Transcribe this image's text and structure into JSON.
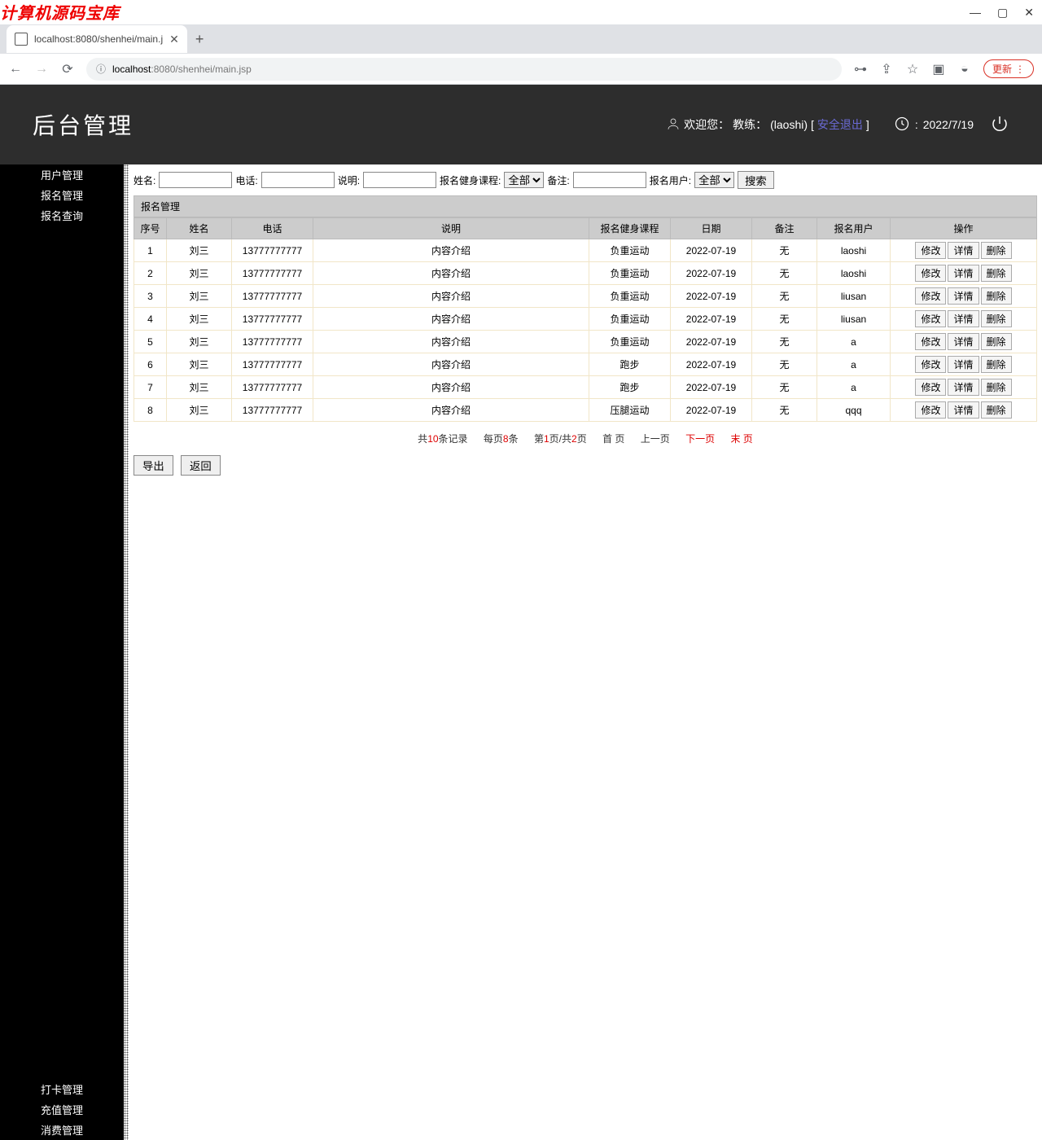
{
  "watermark": "计算机源码宝库",
  "browser": {
    "tab_title": "localhost:8080/shenhei/main.j",
    "url_host": "localhost",
    "url_port": ":8080",
    "url_path": "/shenhei/main.jsp",
    "update_label": "更新",
    "win_min": "—",
    "win_max": "▢",
    "win_close": "✕",
    "new_tab": "+",
    "tab_close": "✕",
    "back": "←",
    "forward": "→",
    "reload": "⟳",
    "info": "ⓘ",
    "key": "⊶",
    "share": "⇪",
    "star": "☆",
    "ext": "▣",
    "user": "◒",
    "more": "⋮"
  },
  "header": {
    "app_title": "后台管理",
    "welcome_prefix": "欢迎您：",
    "role": "教练：",
    "username": "(laoshi)",
    "bracket_open": "[",
    "bracket_close": "]",
    "logout_link": "安全退出",
    "date": "2022/7/19",
    "clock_symbol": "⏱"
  },
  "sidebar": {
    "top": [
      "用户管理",
      "报名管理",
      "报名查询"
    ],
    "bottom": [
      "打卡管理",
      "充值管理",
      "消费管理"
    ]
  },
  "search": {
    "name_label": "姓名:",
    "phone_label": "电话:",
    "desc_label": "说明:",
    "course_label": "报名健身课程:",
    "course_value": "全部",
    "remark_label": "备注:",
    "user_label": "报名用户:",
    "user_value": "全部",
    "button": "搜索",
    "name_val": "",
    "phone_val": "",
    "desc_val": "",
    "remark_val": ""
  },
  "panel_title": "报名管理",
  "columns": [
    "序号",
    "姓名",
    "电话",
    "说明",
    "报名健身课程",
    "日期",
    "备注",
    "报名用户",
    "操作"
  ],
  "ops": {
    "edit": "修改",
    "detail": "详情",
    "delete": "删除"
  },
  "rows": [
    {
      "idx": "1",
      "name": "刘三",
      "phone": "13777777777",
      "desc": "内容介绍",
      "course": "负重运动",
      "date": "2022-07-19",
      "remark": "无",
      "user": "laoshi"
    },
    {
      "idx": "2",
      "name": "刘三",
      "phone": "13777777777",
      "desc": "内容介绍",
      "course": "负重运动",
      "date": "2022-07-19",
      "remark": "无",
      "user": "laoshi"
    },
    {
      "idx": "3",
      "name": "刘三",
      "phone": "13777777777",
      "desc": "内容介绍",
      "course": "负重运动",
      "date": "2022-07-19",
      "remark": "无",
      "user": "liusan"
    },
    {
      "idx": "4",
      "name": "刘三",
      "phone": "13777777777",
      "desc": "内容介绍",
      "course": "负重运动",
      "date": "2022-07-19",
      "remark": "无",
      "user": "liusan"
    },
    {
      "idx": "5",
      "name": "刘三",
      "phone": "13777777777",
      "desc": "内容介绍",
      "course": "负重运动",
      "date": "2022-07-19",
      "remark": "无",
      "user": "a"
    },
    {
      "idx": "6",
      "name": "刘三",
      "phone": "13777777777",
      "desc": "内容介绍",
      "course": "跑步",
      "date": "2022-07-19",
      "remark": "无",
      "user": "a"
    },
    {
      "idx": "7",
      "name": "刘三",
      "phone": "13777777777",
      "desc": "内容介绍",
      "course": "跑步",
      "date": "2022-07-19",
      "remark": "无",
      "user": "a"
    },
    {
      "idx": "8",
      "name": "刘三",
      "phone": "13777777777",
      "desc": "内容介绍",
      "course": "压腿运动",
      "date": "2022-07-19",
      "remark": "无",
      "user": "qqq"
    }
  ],
  "pagination": {
    "p1a": "共",
    "p1b": "10",
    "p1c": "条记录",
    "p2a": "每页",
    "p2b": "8",
    "p2c": "条",
    "p3a": "第",
    "p3b": "1",
    "p3c": "页/共",
    "p3d": "2",
    "p3e": "页",
    "first": "首 页",
    "prev": "上一页",
    "next": "下一页",
    "last": "末 页"
  },
  "bottom": {
    "export": "导出",
    "back": "返回"
  }
}
